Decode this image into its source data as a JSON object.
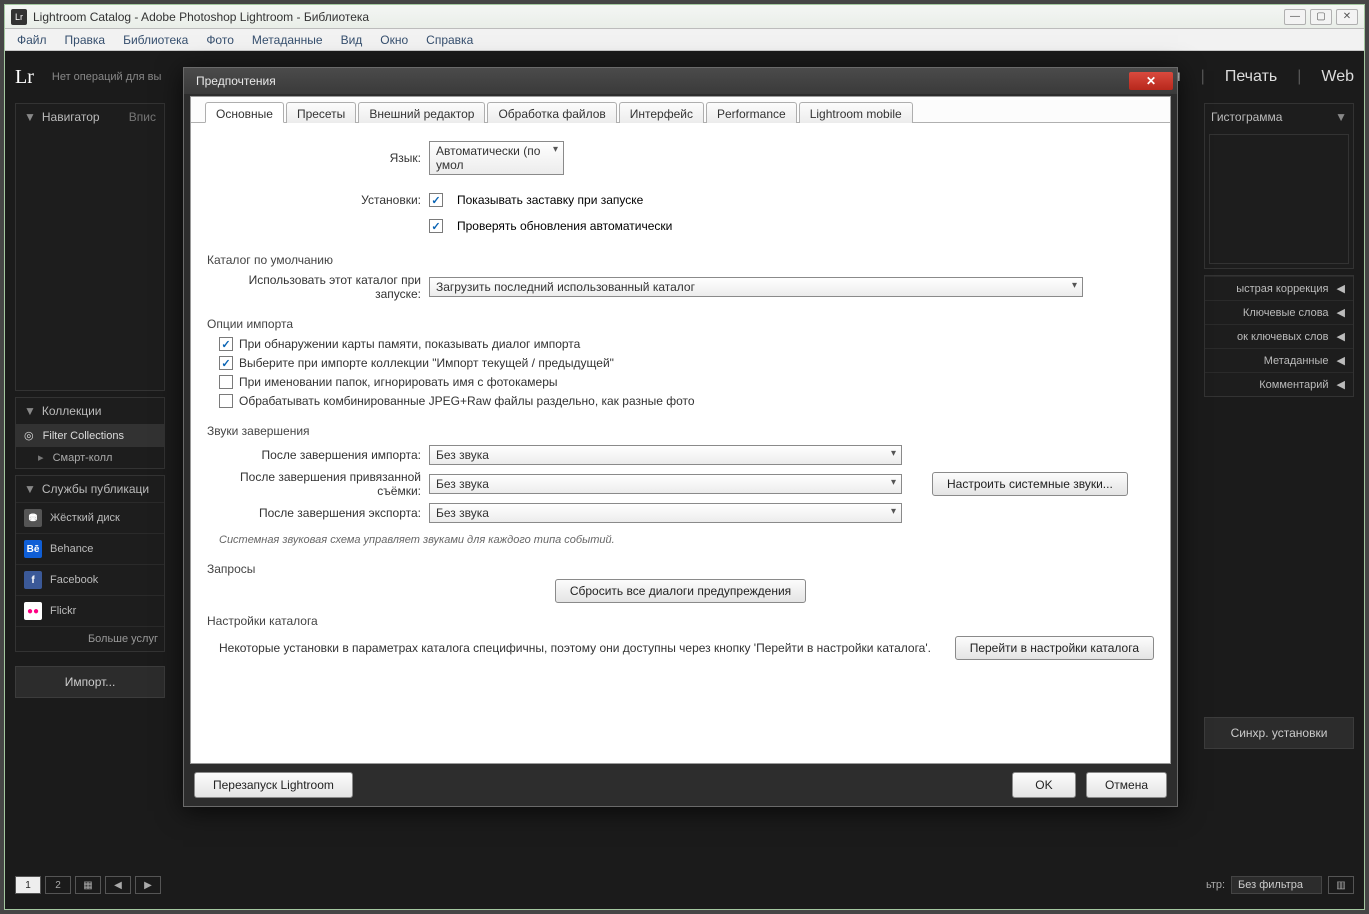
{
  "app": {
    "title": "Lightroom Catalog - Adobe Photoshop Lightroom - Библиотека",
    "icon": "Lr"
  },
  "menubar": [
    "Файл",
    "Правка",
    "Библиотека",
    "Фото",
    "Метаданные",
    "Вид",
    "Окно",
    "Справка"
  ],
  "lr": {
    "logo": "Lr",
    "no_op": "Нет операций для вы",
    "modules": {
      "print": "Печать",
      "web": "Web"
    }
  },
  "left": {
    "navigator": "Навигатор",
    "navigator_sub": "Впис",
    "collections": "Коллекции",
    "filter_collections": "Filter Collections",
    "smart": "Смарт-колл",
    "publish_services": "Службы публикаци",
    "svc": {
      "hdd": "Жёсткий диск",
      "behance": "Behance",
      "facebook": "Facebook",
      "flickr": "Flickr"
    },
    "more": "Больше услуг",
    "import": "Импорт..."
  },
  "right": {
    "histogram": "Гистограмма",
    "quick": "ыстрая коррекция",
    "keywords": "Ключевые слова",
    "keyword_list": "ок ключевых слов",
    "metadata": "Метаданные",
    "comment": "Комментарий",
    "sync": "Синхр. установки"
  },
  "bottombar": {
    "filter_label": "ьтр:",
    "no_filter": "Без фильтра"
  },
  "dialog": {
    "title": "Предпочтения",
    "tabs": [
      "Основные",
      "Пресеты",
      "Внешний редактор",
      "Обработка файлов",
      "Интерфейс",
      "Performance",
      "Lightroom mobile"
    ],
    "lang_label": "Язык:",
    "lang_value": "Автоматически (по умол",
    "install_label": "Установки:",
    "splash": "Показывать заставку при запуске",
    "check_updates": "Проверять обновления автоматически",
    "default_catalog_title": "Каталог по умолчанию",
    "use_catalog_label": "Использовать этот каталог при запуске:",
    "use_catalog_value": "Загрузить последний использованный каталог",
    "import_opts_title": "Опции импорта",
    "imp1": "При обнаружении карты памяти, показывать диалог импорта",
    "imp2": "Выберите при импорте коллекции \"Импорт текущей / предыдущей\"",
    "imp3": "При именовании папок, игнорировать имя с фотокамеры",
    "imp4": "Обрабатывать комбинированные JPEG+Raw файлы раздельно, как разные фото",
    "sounds_title": "Звуки завершения",
    "s_import_label": "После завершения импорта:",
    "s_tether_label": "После завершения привязанной съёмки:",
    "s_export_label": "После завершения экспорта:",
    "no_sound": "Без звука",
    "sys_sounds_btn": "Настроить системные звуки...",
    "sounds_hint": "Системная звуковая схема управляет звуками для каждого типа событий.",
    "requests_title": "Запросы",
    "reset_dialogs_btn": "Сбросить все диалоги предупреждения",
    "catalog_settings_title": "Настройки каталога",
    "catalog_hint": "Некоторые установки в параметрах каталога специфичны, поэтому они доступны через кнопку 'Перейти в настройки каталога'.",
    "goto_catalog_btn": "Перейти в настройки каталога",
    "restart_btn": "Перезапуск Lightroom",
    "ok": "OK",
    "cancel": "Отмена"
  }
}
